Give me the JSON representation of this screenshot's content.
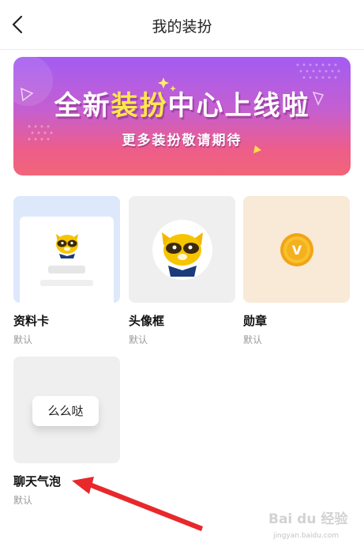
{
  "header": {
    "title": "我的装扮"
  },
  "banner": {
    "title_pre": "全新",
    "title_highlight": "装扮",
    "title_post": "中心上线啦",
    "subtitle": "更多装扮敬请期待"
  },
  "cards": [
    {
      "name": "资料卡",
      "status": "默认"
    },
    {
      "name": "头像框",
      "status": "默认"
    },
    {
      "name": "勋章",
      "status": "默认"
    },
    {
      "name": "聊天气泡",
      "status": "默认"
    }
  ],
  "bubble_sample": "么么哒",
  "medal_letter": "V",
  "watermark": {
    "brand": "Bai du 经验",
    "url": "jingyan.baidu.com"
  },
  "colors": {
    "banner_top": "#a35cf2",
    "banner_bottom": "#f16578",
    "banner_highlight": "#ffe94a",
    "profile_card_bg": "#dde8fb",
    "medal_card_bg": "#f8ead6",
    "medal_gold": "#f7b21c",
    "arrow_red": "#e8282a"
  }
}
